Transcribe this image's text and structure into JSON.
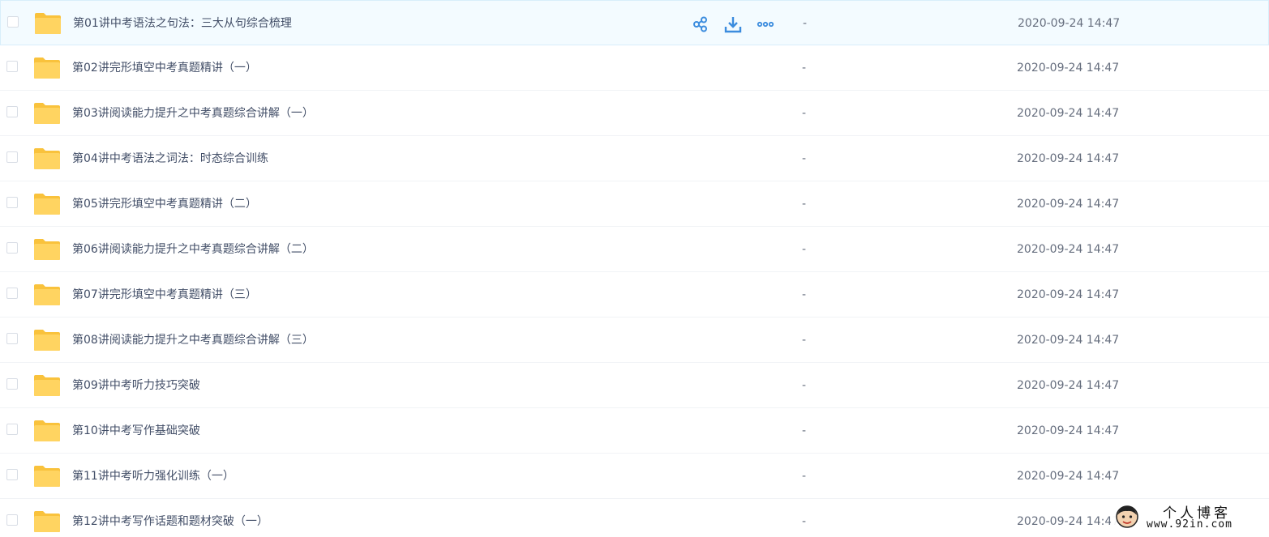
{
  "rows": [
    {
      "name": "第01讲中考语法之句法：三大从句综合梳理",
      "size": "-",
      "date": "2020-09-24 14:47"
    },
    {
      "name": "第02讲完形填空中考真题精讲（一）",
      "size": "-",
      "date": "2020-09-24 14:47"
    },
    {
      "name": "第03讲阅读能力提升之中考真题综合讲解（一）",
      "size": "-",
      "date": "2020-09-24 14:47"
    },
    {
      "name": "第04讲中考语法之词法：时态综合训练",
      "size": "-",
      "date": "2020-09-24 14:47"
    },
    {
      "name": "第05讲完形填空中考真题精讲（二）",
      "size": "-",
      "date": "2020-09-24 14:47"
    },
    {
      "name": "第06讲阅读能力提升之中考真题综合讲解（二）",
      "size": "-",
      "date": "2020-09-24 14:47"
    },
    {
      "name": "第07讲完形填空中考真题精讲（三）",
      "size": "-",
      "date": "2020-09-24 14:47"
    },
    {
      "name": "第08讲阅读能力提升之中考真题综合讲解（三）",
      "size": "-",
      "date": "2020-09-24 14:47"
    },
    {
      "name": "第09讲中考听力技巧突破",
      "size": "-",
      "date": "2020-09-24 14:47"
    },
    {
      "name": "第10讲中考写作基础突破",
      "size": "-",
      "date": "2020-09-24 14:47"
    },
    {
      "name": "第11讲中考听力强化训练（一）",
      "size": "-",
      "date": "2020-09-24 14:47"
    },
    {
      "name": "第12讲中考写作话题和题材突破（一）",
      "size": "-",
      "date": "2020-09-24 14:47"
    }
  ],
  "hover_actions": [
    {
      "icon": "share-icon"
    },
    {
      "icon": "download-icon"
    },
    {
      "icon": "more-icon"
    }
  ],
  "colors": {
    "folder": "#ffd461",
    "folder_tab": "#f9c23c",
    "accent": "#3b8cde",
    "hover_bg": "#f3fbff"
  },
  "watermark": {
    "title": "个人博客",
    "url": "www.92in.com"
  }
}
